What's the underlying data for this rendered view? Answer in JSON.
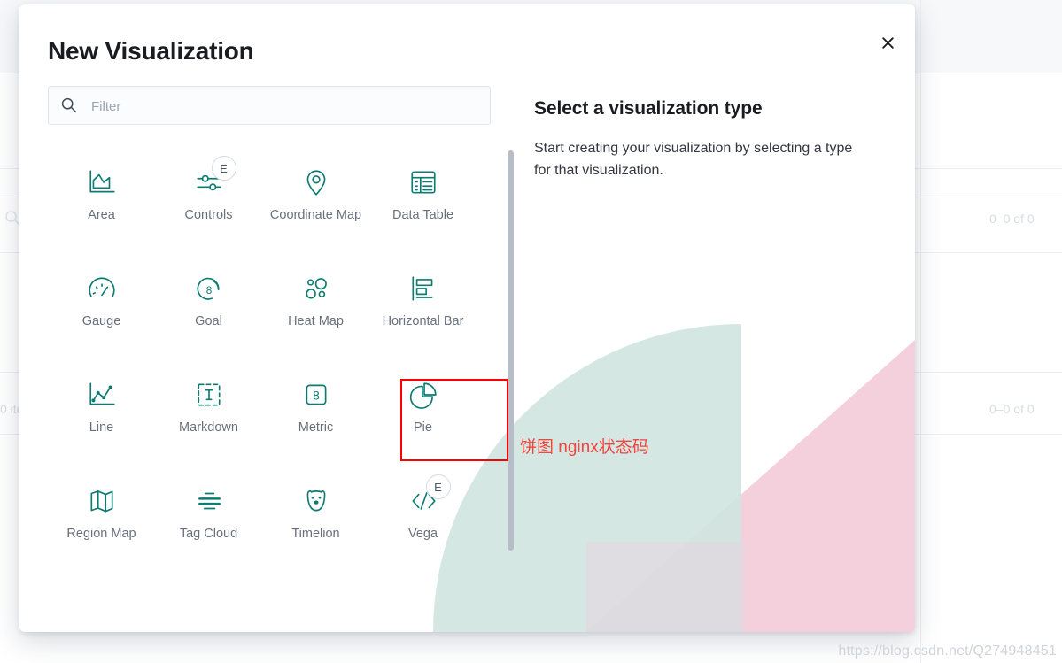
{
  "modal": {
    "title": "New Visualization",
    "close_label": "Close",
    "filter": {
      "value": "",
      "placeholder": "Filter",
      "icon": "search-icon"
    },
    "viz_types": [
      {
        "label": "Area",
        "icon": "area-chart-icon",
        "badge": null,
        "selected": false
      },
      {
        "label": "Controls",
        "icon": "controls-icon",
        "badge": "E",
        "selected": false
      },
      {
        "label": "Coordinate Map",
        "icon": "map-marker-icon",
        "badge": null,
        "selected": false
      },
      {
        "label": "Data Table",
        "icon": "data-table-icon",
        "badge": null,
        "selected": false
      },
      {
        "label": "Gauge",
        "icon": "gauge-icon",
        "badge": null,
        "selected": false
      },
      {
        "label": "Goal",
        "icon": "goal-icon",
        "badge": null,
        "selected": false
      },
      {
        "label": "Heat Map",
        "icon": "heat-map-icon",
        "badge": null,
        "selected": false
      },
      {
        "label": "Horizontal Bar",
        "icon": "horizontal-bar-icon",
        "badge": null,
        "selected": false
      },
      {
        "label": "Line",
        "icon": "line-chart-icon",
        "badge": null,
        "selected": false
      },
      {
        "label": "Markdown",
        "icon": "markdown-icon",
        "badge": null,
        "selected": false
      },
      {
        "label": "Metric",
        "icon": "metric-icon",
        "badge": null,
        "selected": false
      },
      {
        "label": "Pie",
        "icon": "pie-chart-icon",
        "badge": null,
        "selected": true
      },
      {
        "label": "Region Map",
        "icon": "region-map-icon",
        "badge": null,
        "selected": false
      },
      {
        "label": "Tag Cloud",
        "icon": "tag-cloud-icon",
        "badge": null,
        "selected": false
      },
      {
        "label": "Timelion",
        "icon": "timelion-icon",
        "badge": null,
        "selected": false
      },
      {
        "label": "Vega",
        "icon": "vega-icon",
        "badge": "E",
        "selected": false
      }
    ],
    "detail": {
      "title": "Select a visualization type",
      "body": "Start creating your visualization by selecting a type for that visualization."
    }
  },
  "annotation": {
    "text": "饼图 nginx状态码",
    "color": "#f4443c",
    "highlight_target": "Pie"
  },
  "background": {
    "result_count_top": "0–0 of 0",
    "result_count_bottom": "0–0 of 0",
    "item_text": "0 ite",
    "search_icon": "search-icon"
  },
  "watermark": {
    "text": "https://blog.csdn.net/Q274948451"
  },
  "colors": {
    "accent": "#0c7b72",
    "annotation": "#ff0000",
    "text_primary": "#1a1c21",
    "text_muted": "#69707d",
    "deco_teal": "#d6e9e4",
    "deco_pink": "#f2ced9"
  }
}
